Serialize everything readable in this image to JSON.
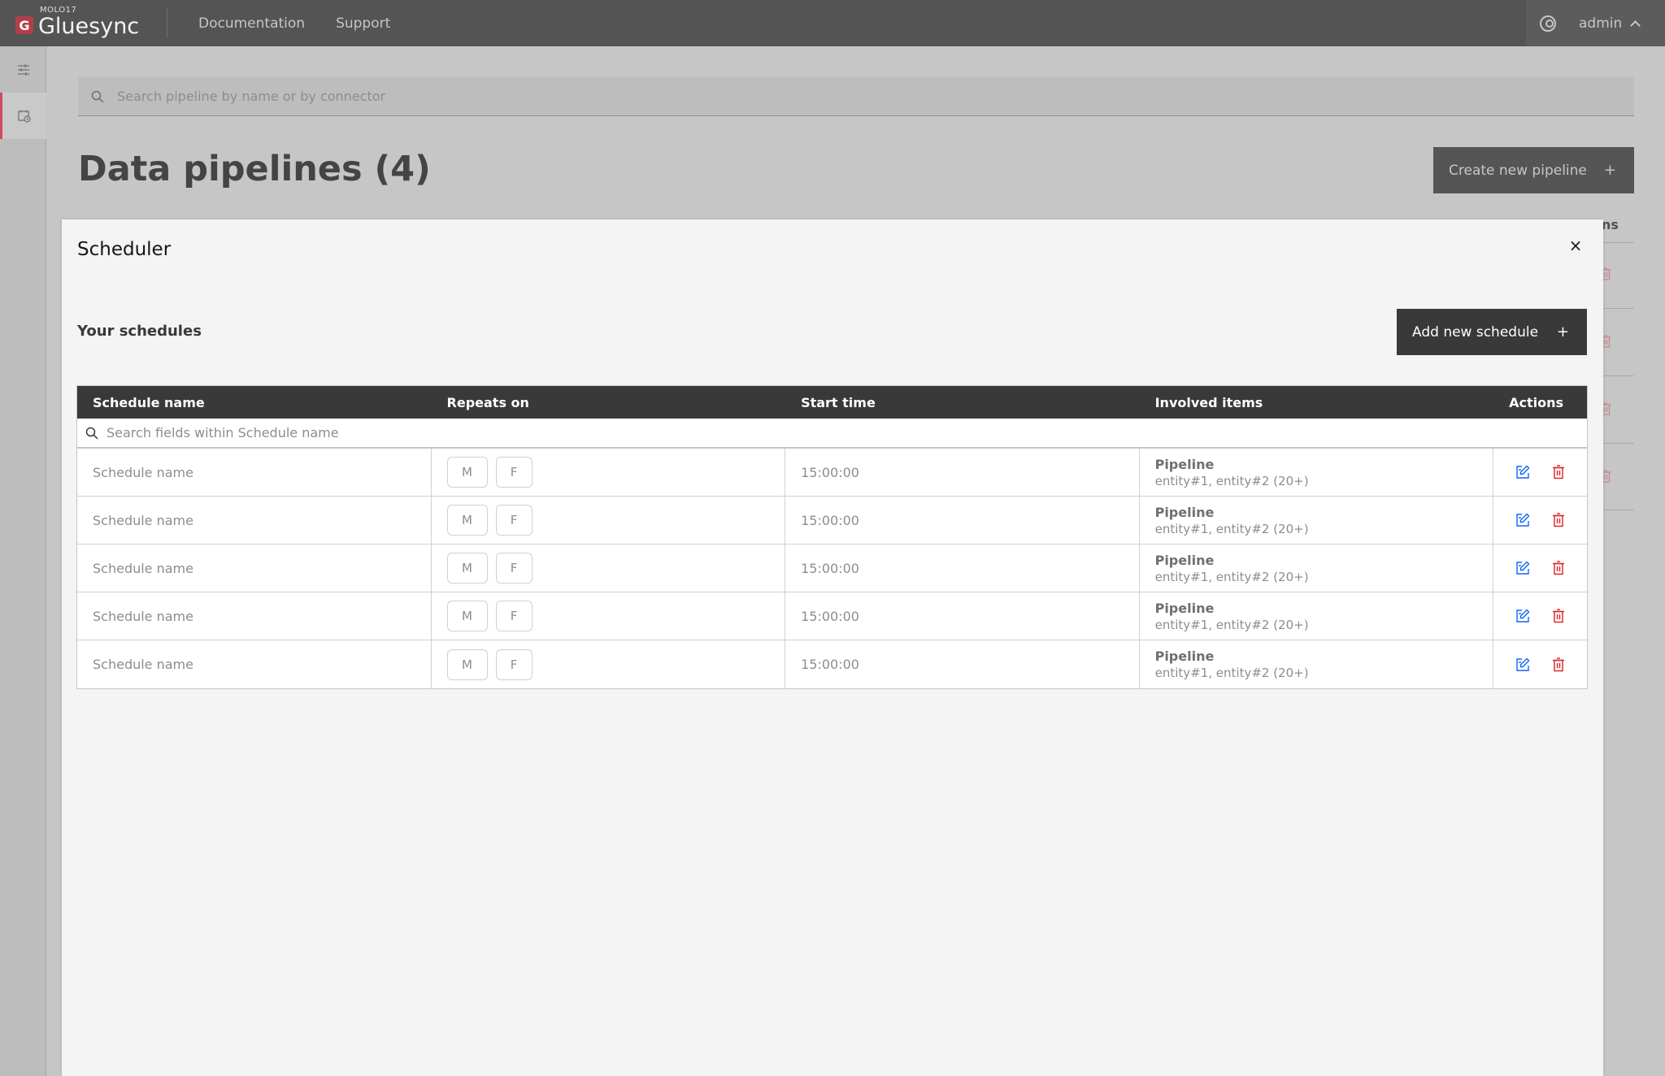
{
  "brand": {
    "super": "MOLO17",
    "name": "Gluesync",
    "logo_letter": "G"
  },
  "nav": [
    {
      "label": "Documentation"
    },
    {
      "label": "Support"
    }
  ],
  "user": {
    "name": "admin"
  },
  "search": {
    "placeholder": "Search pipeline by name or by connector"
  },
  "page": {
    "title": "Data pipelines (4)",
    "create_label": "Create new pipeline",
    "plus": "+",
    "actions_col_partial": "ns"
  },
  "modal": {
    "title": "Scheduler",
    "close": "×",
    "section_title": "Your schedules",
    "add_label": "Add new schedule",
    "plus": "+",
    "columns": [
      "Schedule name",
      "Repeats on",
      "Start time",
      "Involved items",
      "Actions"
    ],
    "table_search_placeholder": "Search fields within Schedule name",
    "rows": [
      {
        "name": "Schedule name",
        "days": [
          "M",
          "F"
        ],
        "time": "15:00:00",
        "items_title": "Pipeline",
        "items_list": "entity#1, entity#2 (20+)"
      },
      {
        "name": "Schedule name",
        "days": [
          "M",
          "F"
        ],
        "time": "15:00:00",
        "items_title": "Pipeline",
        "items_list": "entity#1, entity#2 (20+)"
      },
      {
        "name": "Schedule name",
        "days": [
          "M",
          "F"
        ],
        "time": "15:00:00",
        "items_title": "Pipeline",
        "items_list": "entity#1, entity#2 (20+)"
      },
      {
        "name": "Schedule name",
        "days": [
          "M",
          "F"
        ],
        "time": "15:00:00",
        "items_title": "Pipeline",
        "items_list": "entity#1, entity#2 (20+)"
      },
      {
        "name": "Schedule name",
        "days": [
          "M",
          "F"
        ],
        "time": "15:00:00",
        "items_title": "Pipeline",
        "items_list": "entity#1, entity#2 (20+)"
      }
    ]
  },
  "colors": {
    "topbar": "#545454",
    "accent_red": "#da1e28",
    "edit_blue": "#0f62fe",
    "header_dark": "#393939"
  },
  "icons": {
    "edit": "edit-icon",
    "delete": "trash-icon",
    "search": "search-icon",
    "user": "user-avatar-icon"
  }
}
